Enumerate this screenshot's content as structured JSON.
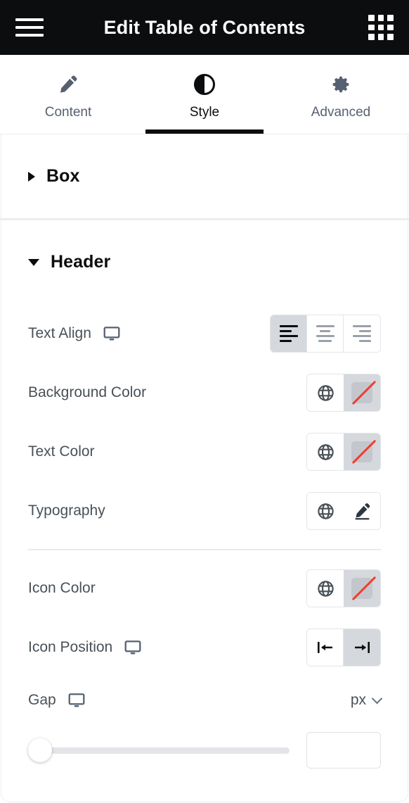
{
  "topbar": {
    "title": "Edit Table of Contents",
    "menu_icon": "hamburger-menu-icon",
    "apps_icon": "grid-apps-icon"
  },
  "tabs": [
    {
      "label": "Content",
      "icon": "pencil-icon",
      "active": false
    },
    {
      "label": "Style",
      "icon": "contrast-icon",
      "active": true
    },
    {
      "label": "Advanced",
      "icon": "gear-icon",
      "active": false
    }
  ],
  "sections": [
    {
      "title": "Box",
      "expanded": false
    },
    {
      "title": "Header",
      "expanded": true
    }
  ],
  "controls": {
    "text_align": {
      "label": "Text Align",
      "device_icon": "desktop-monitor-icon",
      "options": [
        {
          "value": "left",
          "icon": "align-left-icon",
          "active": true
        },
        {
          "value": "center",
          "icon": "align-center-icon",
          "active": false
        },
        {
          "value": "right",
          "icon": "align-right-icon",
          "active": false
        }
      ]
    },
    "background_color": {
      "label": "Background Color",
      "globals_icon": "globe-globals-icon",
      "swatch_state": "none"
    },
    "text_color": {
      "label": "Text Color",
      "globals_icon": "globe-globals-icon",
      "swatch_state": "none"
    },
    "typography": {
      "label": "Typography",
      "globals_icon": "globe-globals-icon",
      "edit_icon": "pencil-edit-icon"
    },
    "icon_color": {
      "label": "Icon Color",
      "globals_icon": "globe-globals-icon",
      "swatch_state": "none"
    },
    "icon_position": {
      "label": "Icon Position",
      "device_icon": "desktop-monitor-icon",
      "options": [
        {
          "value": "start",
          "icon": "arrow-to-left-icon",
          "active": false
        },
        {
          "value": "end",
          "icon": "arrow-to-right-icon",
          "active": true
        }
      ]
    },
    "gap": {
      "label": "Gap",
      "device_icon": "desktop-monitor-icon",
      "unit": "px",
      "unit_chevron": "chevron-down-icon",
      "slider_value": 0,
      "slider_min": 0,
      "slider_max": 100,
      "input_value": "",
      "input_placeholder": ""
    }
  },
  "colors": {
    "topbar_bg": "#0c0d0e",
    "topbar_text": "#ffffff",
    "panel_bg": "#ffffff",
    "label_text": "#495157",
    "muted_text": "#566070",
    "active_tab_text": "#0c0d0e",
    "control_border": "#e3e5e8",
    "active_choice_bg": "#d5d8dc",
    "swatch_fill": "#c3c7cd",
    "no_color_slash": "#ee3e2f",
    "slider_track": "#e3e5e8",
    "divider": "#e8eaec",
    "section_separator": "#ececee"
  }
}
